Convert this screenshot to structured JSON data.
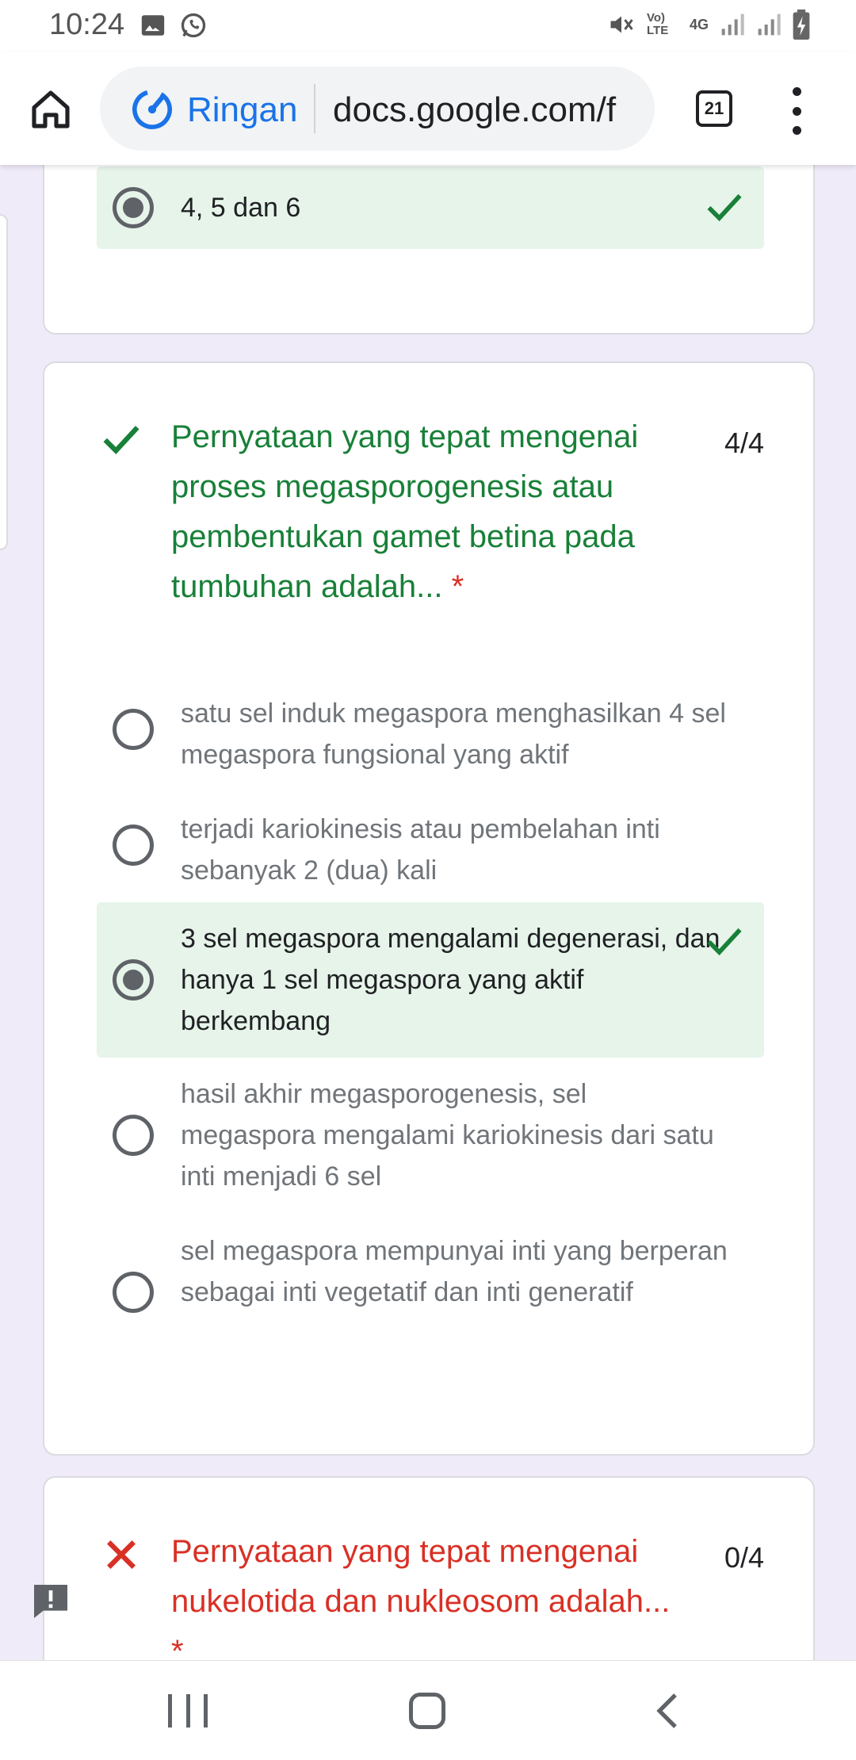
{
  "status_bar": {
    "time": "10:24",
    "left_icons": [
      "image-icon",
      "whatsapp-icon"
    ],
    "network": "4G",
    "volte": "Vo) LTE",
    "right_icons": [
      "mute-icon",
      "volte-icon",
      "network-4g-icon",
      "signal-icon",
      "signal-icon",
      "battery-charging-icon"
    ]
  },
  "browser": {
    "lite_label": "Ringan",
    "url": "docs.google.com/f",
    "tab_count": "21"
  },
  "card1": {
    "option": {
      "label": "4, 5 dan 6",
      "selected": true,
      "correct": true
    }
  },
  "question2": {
    "title": "Pernyataan yang tepat mengenai proses megasporogenesis atau pembentukan gamet betina pada tumbuhan adalah...",
    "required_mark": "*",
    "score": "4/4",
    "status": "correct",
    "options": [
      {
        "label": "satu sel induk megaspora menghasilkan 4 sel megaspora fungsional yang aktif",
        "selected": false
      },
      {
        "label": "terjadi kariokinesis atau pembelahan inti sebanyak 2 (dua) kali",
        "selected": false
      },
      {
        "label": "3 sel megaspora mengalami degenerasi, dan hanya 1 sel megaspora yang aktif berkembang",
        "selected": true,
        "correct": true
      },
      {
        "label": "hasil akhir megasporogenesis, sel megaspora mengalami kariokinesis dari satu inti menjadi 6 sel",
        "selected": false
      },
      {
        "label": "sel megaspora mempunyai inti yang berperan sebagai inti vegetatif dan inti generatif",
        "selected": false
      }
    ]
  },
  "question3": {
    "title": "Pernyataan yang tepat mengenai nukelotida dan nukleosom adalah...",
    "required_mark": "*",
    "score": "0/4",
    "status": "incorrect"
  },
  "colors": {
    "correct_green": "#188038",
    "correct_bg": "#e6f4ea",
    "incorrect_red": "#d93025",
    "form_bg": "#f0ebf8",
    "link_blue": "#1a73e8"
  }
}
